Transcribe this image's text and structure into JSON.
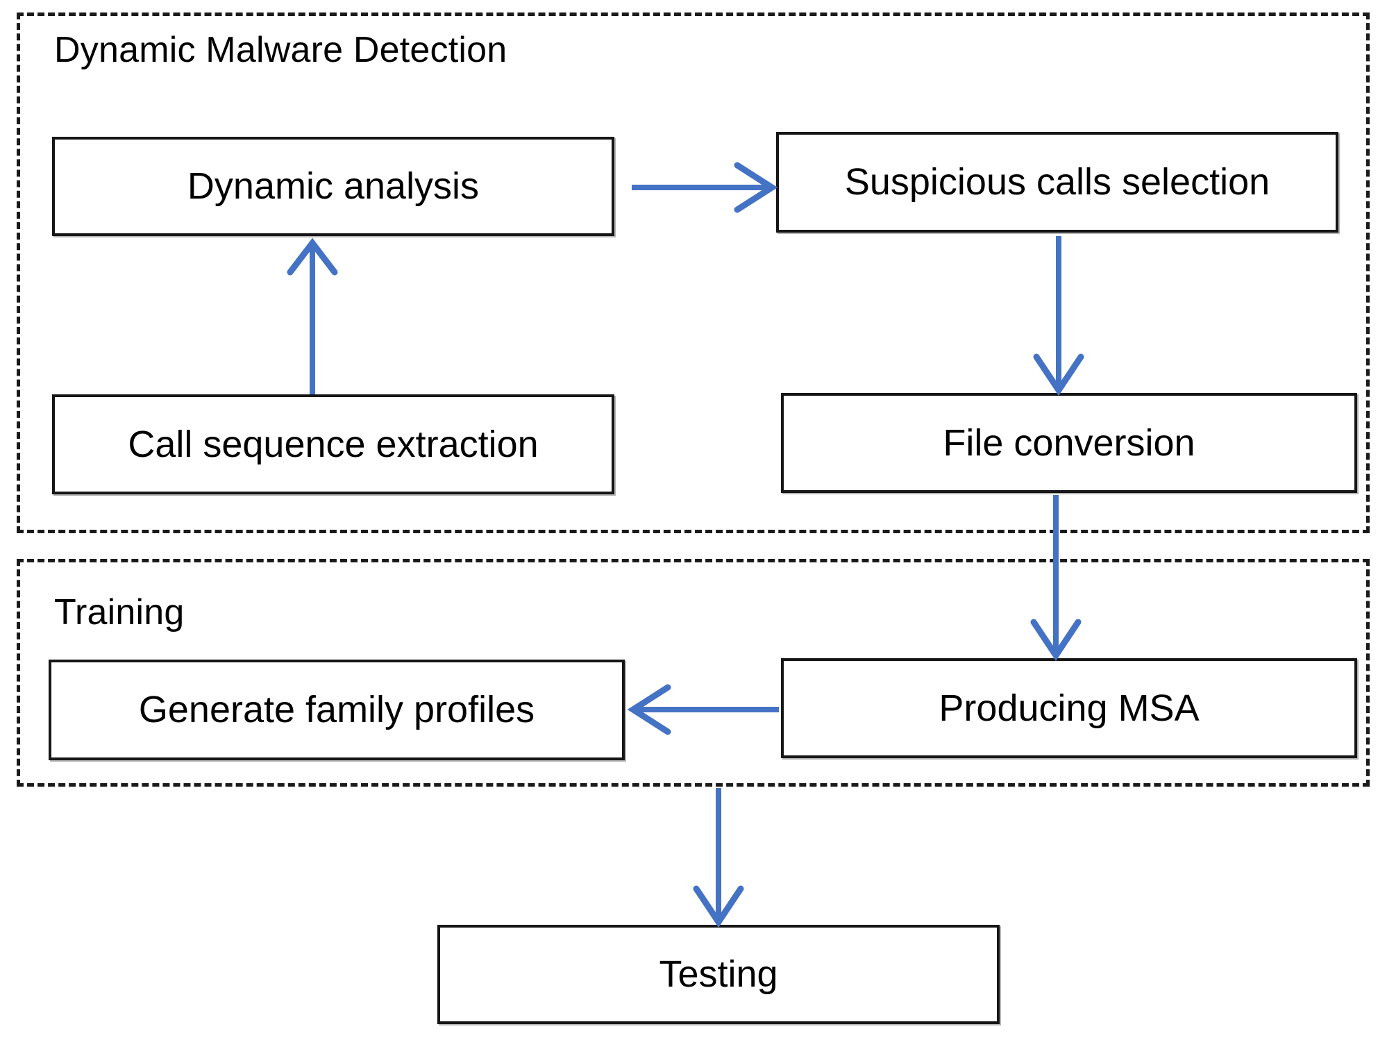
{
  "diagram": {
    "title": "Dynamic Malware Detection pipeline flowchart",
    "accent_color": "#4472C4",
    "box_border_color": "#161616",
    "group_border_color": "#1a1a1a",
    "background_color": "#FFFFFF"
  },
  "groups": [
    {
      "id": "dynamic-malware-detection",
      "label": "Dynamic Malware Detection"
    },
    {
      "id": "training",
      "label": "Training"
    }
  ],
  "nodes": [
    {
      "id": "dynamic-analysis",
      "label": "Dynamic analysis"
    },
    {
      "id": "suspicious-calls-selection",
      "label": "Suspicious calls selection"
    },
    {
      "id": "call-sequence-extraction",
      "label": "Call sequence extraction"
    },
    {
      "id": "file-conversion",
      "label": "File conversion"
    },
    {
      "id": "generate-family-profiles",
      "label": "Generate family profiles"
    },
    {
      "id": "producing-msa",
      "label": "Producing MSA"
    },
    {
      "id": "testing",
      "label": "Testing"
    }
  ],
  "edges": [
    {
      "id": "edge-call-sequence-to-dynamic-analysis",
      "from": "call-sequence-extraction",
      "to": "dynamic-analysis",
      "direction": "up"
    },
    {
      "id": "edge-dynamic-analysis-to-suspicious-calls",
      "from": "dynamic-analysis",
      "to": "suspicious-calls-selection",
      "direction": "right"
    },
    {
      "id": "edge-suspicious-calls-to-file-conversion",
      "from": "suspicious-calls-selection",
      "to": "file-conversion",
      "direction": "down"
    },
    {
      "id": "edge-file-conversion-to-producing-msa",
      "from": "file-conversion",
      "to": "producing-msa",
      "direction": "down"
    },
    {
      "id": "edge-producing-msa-to-generate-family-profiles",
      "from": "producing-msa",
      "to": "generate-family-profiles",
      "direction": "left"
    },
    {
      "id": "edge-training-to-testing",
      "from": "training",
      "to": "testing",
      "direction": "down"
    }
  ]
}
